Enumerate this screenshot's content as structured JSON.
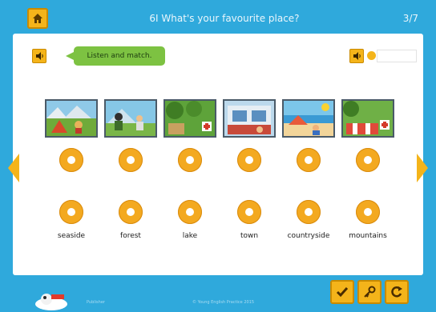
{
  "header": {
    "title": "6I What's your favourite place?",
    "page_indicator": "3/7"
  },
  "instruction": {
    "text": "Listen and match."
  },
  "pictures": [
    {
      "scene": "seaside-camping"
    },
    {
      "scene": "forest-hikers"
    },
    {
      "scene": "lake-park"
    },
    {
      "scene": "town-shop"
    },
    {
      "scene": "countryside-beach"
    },
    {
      "scene": "mountains-picnic"
    }
  ],
  "words": [
    "seaside",
    "forest",
    "lake",
    "town",
    "countryside",
    "mountains"
  ],
  "controls": {
    "check_icon": "check-icon",
    "key_icon": "key-icon",
    "reset_icon": "reset-icon",
    "home_icon": "home-icon",
    "speaker_icon": "speaker-icon"
  },
  "footer": {
    "left_text": "Publisher",
    "center_text": "© Young English Practice 2015"
  },
  "colors": {
    "background": "#2fa9dc",
    "accent": "#f4b41a",
    "bubble": "#7dc242",
    "panel": "#ffffff"
  }
}
